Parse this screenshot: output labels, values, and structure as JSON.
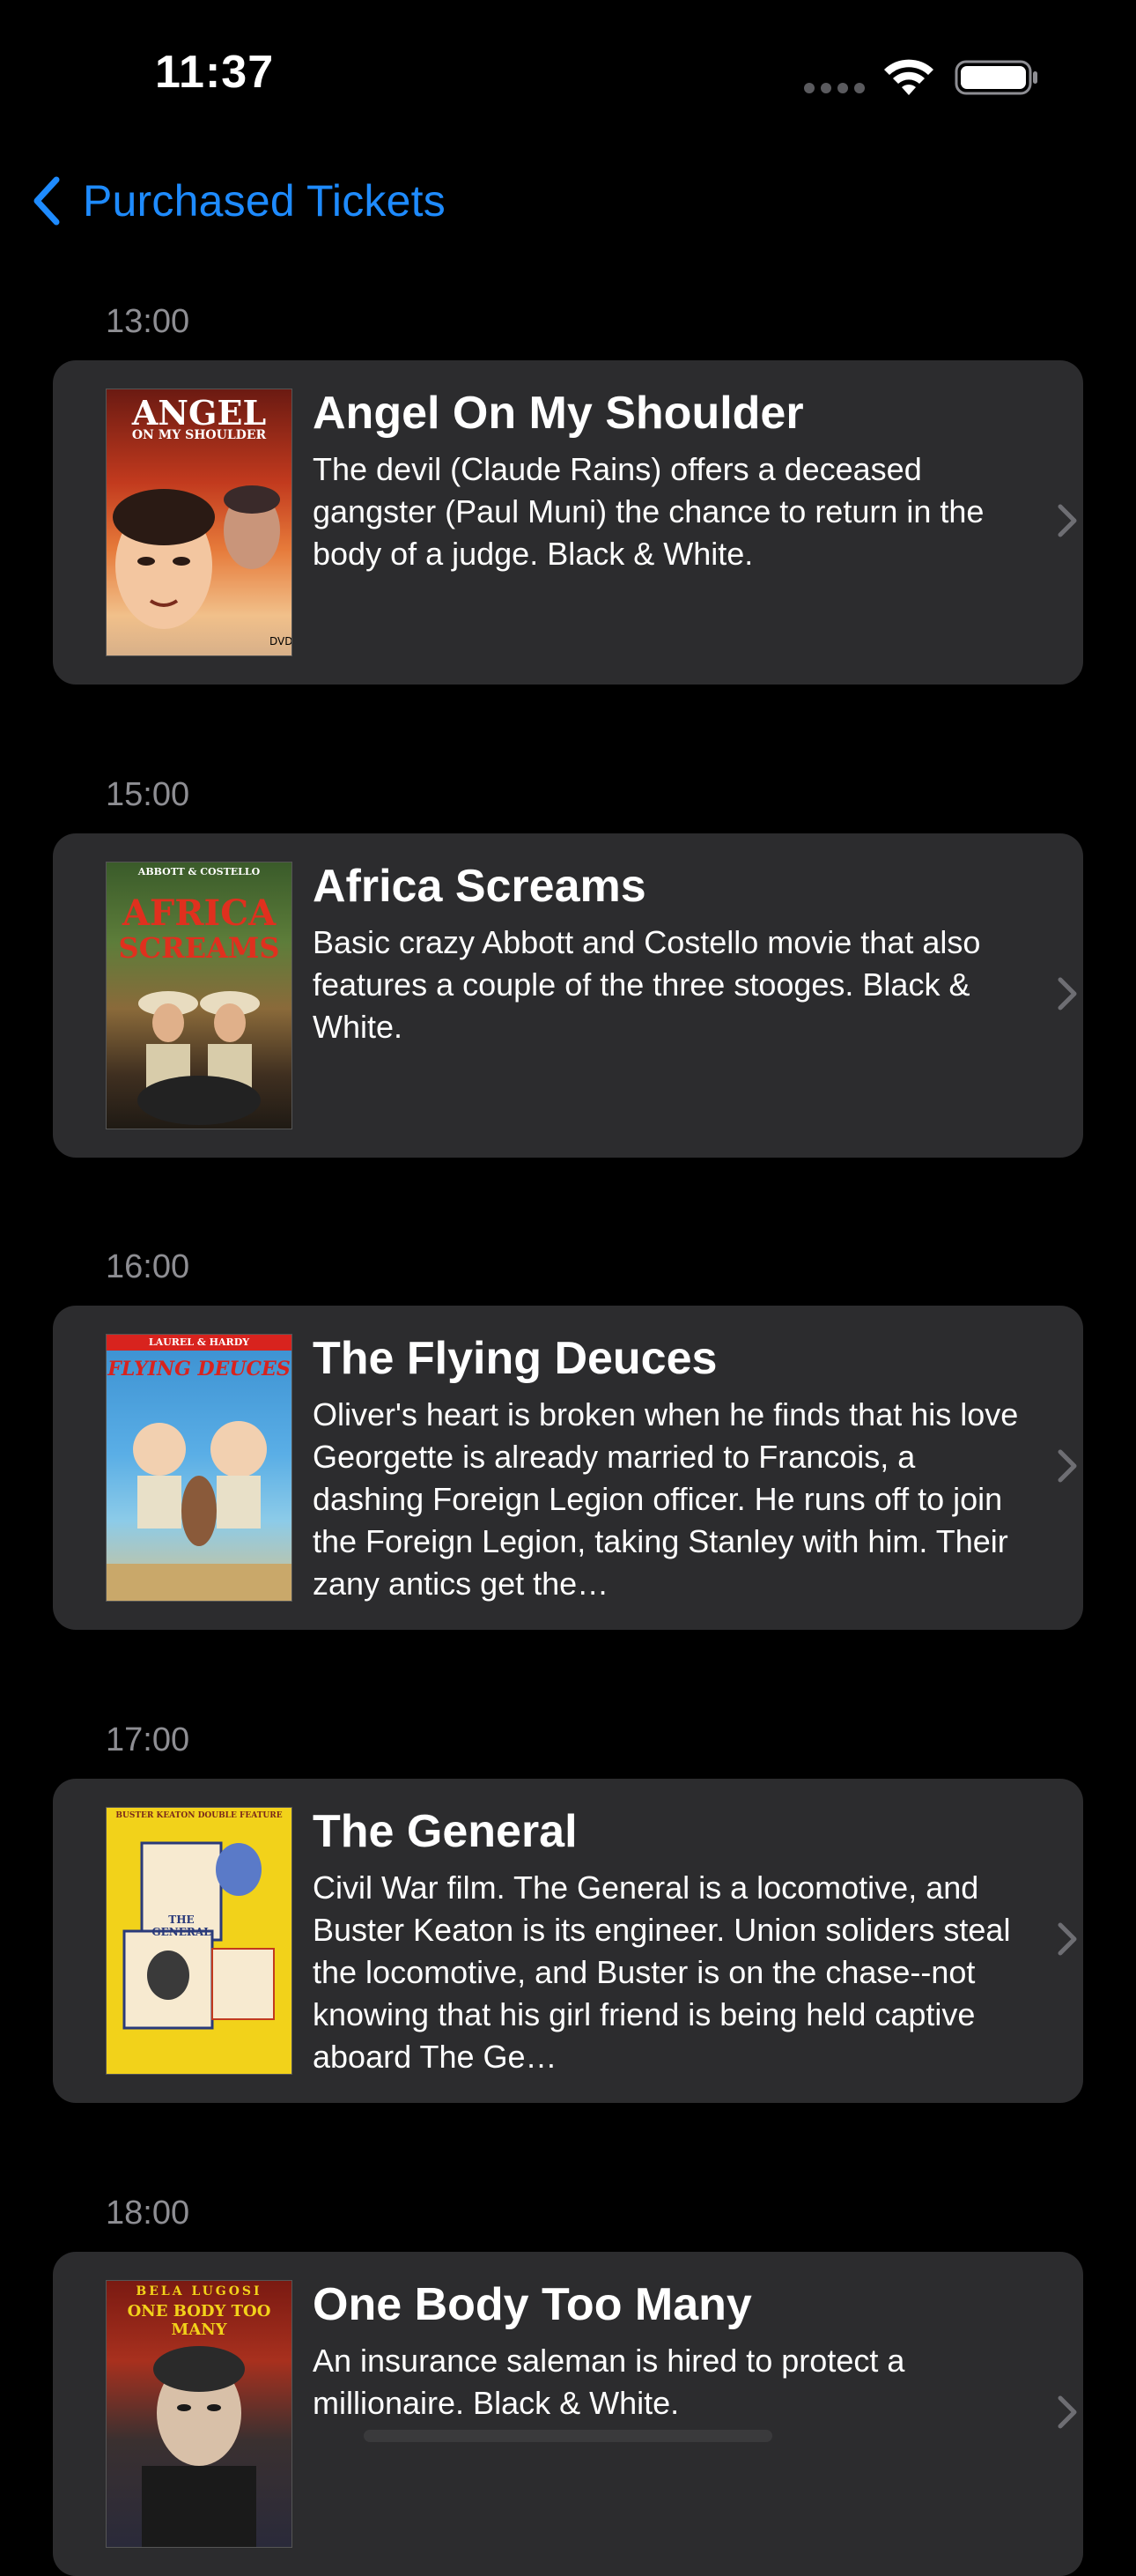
{
  "status_bar": {
    "time": "11:37"
  },
  "nav": {
    "back_label": "Purchased Tickets"
  },
  "colors": {
    "accent": "#1e8bff",
    "card_bg": "#2c2c2e",
    "secondary_text": "#8e8e93"
  },
  "tickets": [
    {
      "time": "13:00",
      "title": "Angel On My Shoulder",
      "description": "The devil (Claude Rains) offers a deceased gangster (Paul Muni) the chance to return in the body of a judge. Black & White.",
      "poster_text": [
        "ANGEL",
        "ON MY SHOULDER"
      ]
    },
    {
      "time": "15:00",
      "title": "Africa Screams",
      "description": "Basic crazy Abbott and Costello movie that also features a couple of the three stooges. Black & White.",
      "poster_text": [
        "ABBOTT & COSTELLO",
        "AFRICA",
        "SCREAMS"
      ]
    },
    {
      "time": "16:00",
      "title": "The Flying Deuces",
      "description": "Oliver's heart is broken when he finds that his love Georgette is already married to Francois, a dashing Foreign Legion officer. He runs off to join the Foreign Legion, taking Stanley with him. Their zany antics get the…",
      "poster_text": [
        "LAUREL & HARDY",
        "FLYING DEUCES"
      ]
    },
    {
      "time": "17:00",
      "title": "The General",
      "description": "Civil War film. The General is a locomotive, and Buster Keaton is its engineer. Union soliders steal the locomotive, and Buster is on the chase--not knowing that his girl friend is being held captive aboard The Ge…",
      "poster_text": [
        "BUSTER KEATON DOUBLE FEATURE",
        "THE GENERAL"
      ]
    },
    {
      "time": "18:00",
      "title": "One Body Too Many",
      "description": "An insurance saleman is hired to protect a millionaire. Black & White.",
      "poster_text": [
        "BELA LUGOSI",
        "ONE BODY TOO MANY"
      ]
    }
  ]
}
